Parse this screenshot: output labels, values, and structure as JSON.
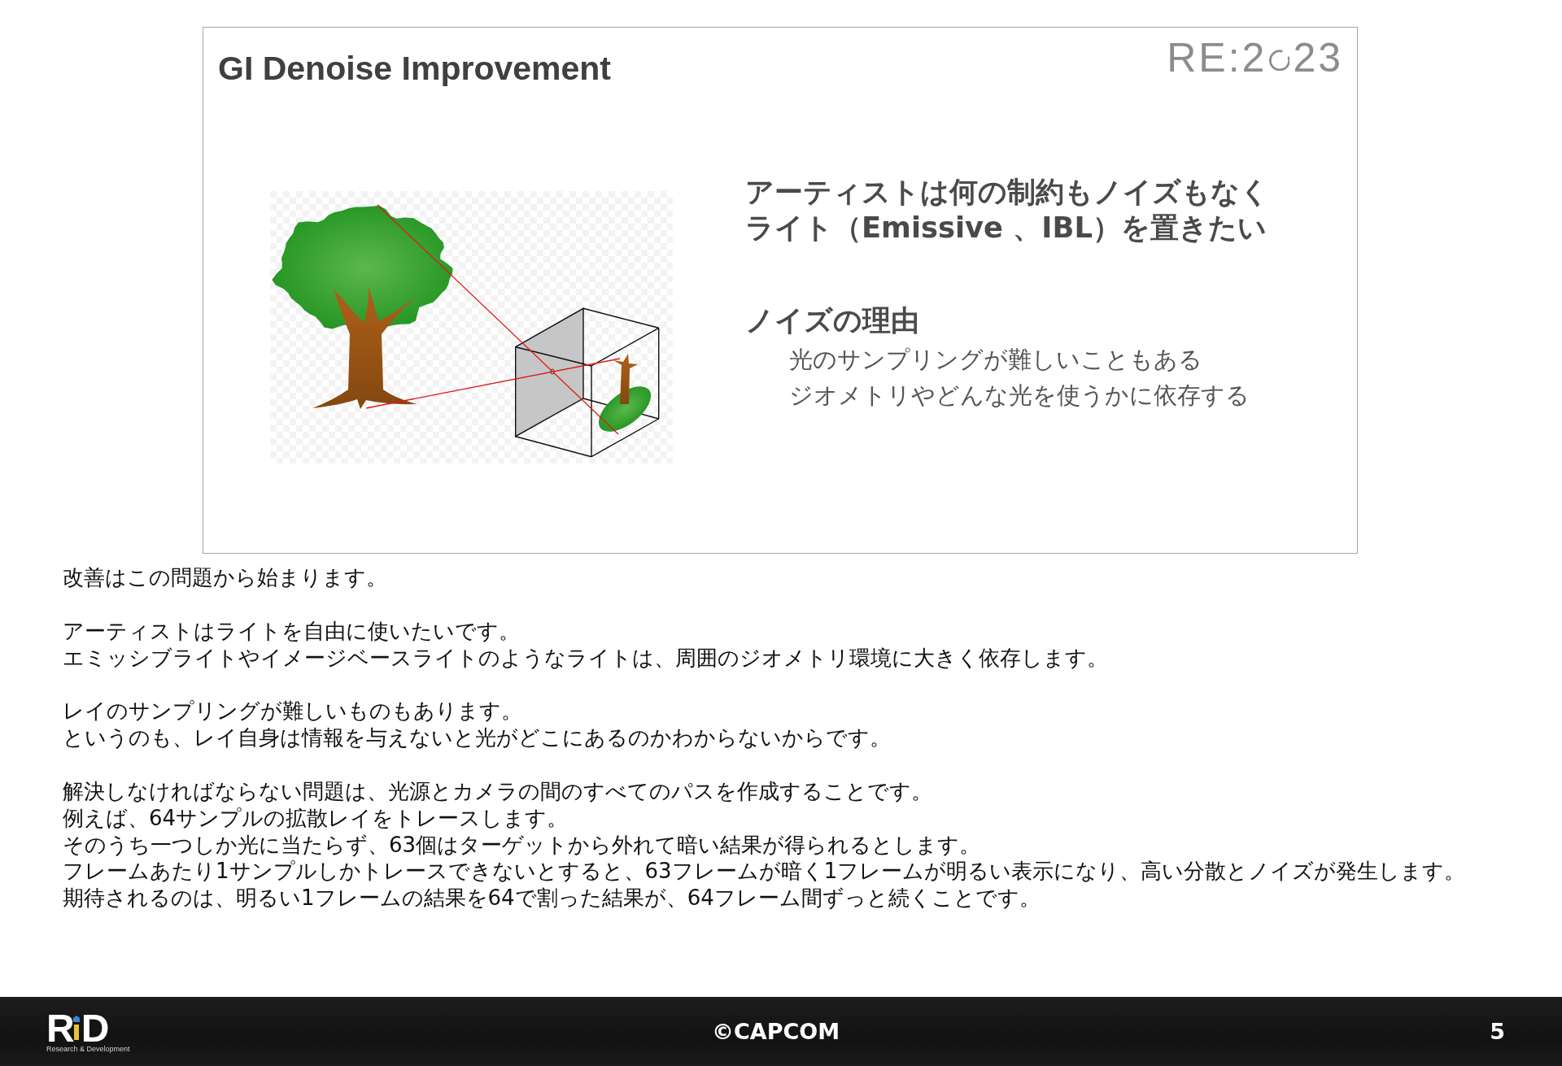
{
  "slide": {
    "title": "GI Denoise Improvement",
    "event_logo": {
      "prefix": "RE:2",
      "suffix": "23"
    },
    "headline": [
      "アーティストは何の制約もノイズもなく",
      "ライト（Emissive 、IBL）を置きたい"
    ],
    "section": {
      "heading": "ノイズの理由",
      "items": [
        "光のサンプリングが難しいこともある",
        "ジオメトリやどんな光を使うかに依存する"
      ]
    }
  },
  "notes": [
    [
      "改善はこの問題から始まります。"
    ],
    [
      "アーティストはライトを自由に使いたいです。",
      "エミッシブライトやイメージベースライトのようなライトは、周囲のジオメトリ環境に大きく依存します。"
    ],
    [
      "レイのサンプリングが難しいものもあります。",
      "というのも、レイ自身は情報を与えないと光がどこにあるのかわからないからです。"
    ],
    [
      "解決しなければならない問題は、光源とカメラの間のすべてのパスを作成することです。",
      "例えば、64サンプルの拡散レイをトレースします。",
      "そのうち一つしか光に当たらず、63個はターゲットから外れて暗い結果が得られるとします。",
      "フレームあたり1サンプルしかトレースできないとすると、63フレームが暗く1フレームが明るい表示になり、高い分散とノイズが発生します。",
      "期待されるのは、明るい1フレームの結果を64で割った結果が、64フレーム間ずっと続くことです。"
    ]
  ],
  "footer": {
    "logo": {
      "left": "R",
      "right": "D",
      "tagline": "Research & Development"
    },
    "copyright": "©CAPCOM",
    "page_number": "5"
  }
}
